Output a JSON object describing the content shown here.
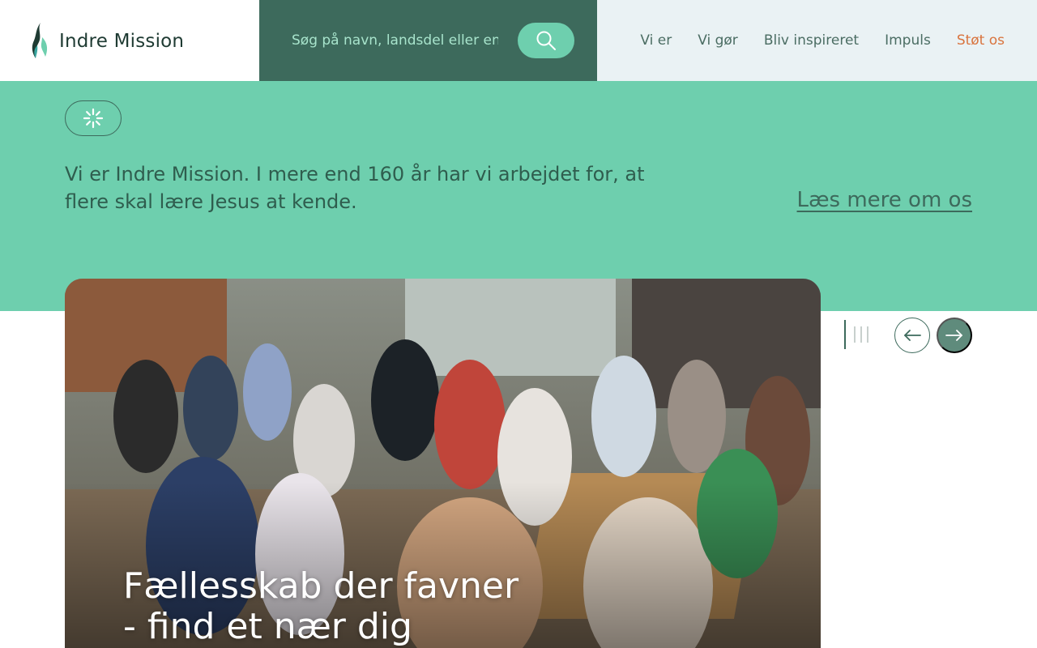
{
  "header": {
    "logo_text": "Indre Mission",
    "search": {
      "placeholder": "Søg på navn, landsdel eller en",
      "button_icon": "search-icon"
    },
    "nav": {
      "items": [
        {
          "label": "Vi er"
        },
        {
          "label": "Vi gør"
        },
        {
          "label": "Bliv inspireret"
        },
        {
          "label": "Impuls"
        },
        {
          "label": "Støt os"
        }
      ],
      "accent_color": "#d9743e"
    }
  },
  "hero": {
    "loading_icon": "spinner-icon",
    "intro_text": "Vi er Indre Mission. I mere end 160 år har vi arbejdet for, at flere skal lære Jesus at kende.",
    "read_more_label": "Læs mere om os",
    "background_color": "#6ecfae"
  },
  "slider": {
    "slide_title_line1": "Fællesskab der favner",
    "slide_title_line2": "- find et nær dig",
    "prev_icon": "arrow-left-icon",
    "next_icon": "arrow-right-icon",
    "progress_indicator_count": 4,
    "active_index": 0
  },
  "colors": {
    "primary_dark": "#3d6a5c",
    "mint": "#6ecfae",
    "nav_bg": "#eaf2f4"
  }
}
